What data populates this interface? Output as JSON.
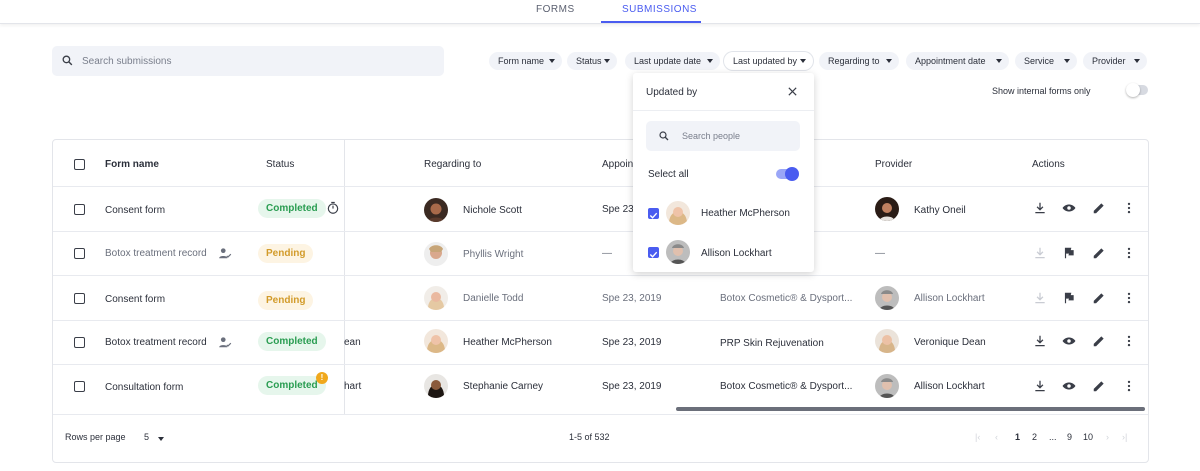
{
  "nav": {
    "tabs": [
      {
        "label": "FORMS"
      },
      {
        "label": "SUBMISSIONS"
      }
    ]
  },
  "search": {
    "placeholder": "Search submissions"
  },
  "filters": [
    "Form name",
    "Status",
    "Last update date",
    "Last updated by",
    "Regarding to",
    "Appointment date",
    "Service",
    "Provider"
  ],
  "internal_toggle": {
    "label": "Show internal forms only",
    "on": false
  },
  "table": {
    "headers": {
      "form_name": "Form name",
      "status": "Status",
      "regarding": "Regarding to",
      "appointment": "Appoin",
      "provider": "Provider",
      "actions": "Actions"
    },
    "rows": [
      {
        "form": "Consent form",
        "status": "Completed",
        "partial": "",
        "regarding": "Nichole Scott",
        "date": "Spe 23",
        "service": "",
        "provider": "Kathy Oneil"
      },
      {
        "form": "Botox treatment record",
        "status": "Pending",
        "partial": "",
        "regarding": "Phyllis Wright",
        "date": "—",
        "service": "",
        "provider": "—"
      },
      {
        "form": "Consent form",
        "status": "Pending",
        "partial": "",
        "regarding": "Danielle Todd",
        "date": "Spe 23, 2019",
        "service": "Botox Cosmetic® & Dysport...",
        "provider": "Allison Lockhart"
      },
      {
        "form": "Botox treatment record",
        "status": "Completed",
        "partial": "ean",
        "regarding": "Heather McPherson",
        "date": "Spe 23, 2019",
        "service": "PRP Skin Rejuvenation",
        "provider": "Veronique Dean"
      },
      {
        "form": "Consultation form",
        "status": "Completed",
        "partial": "hart",
        "regarding": "Stephanie Carney",
        "date": "Spe 23, 2019",
        "service": "Botox Cosmetic® & Dysport...",
        "provider": "Allison Lockhart"
      }
    ]
  },
  "footer": {
    "rows_per_page_label": "Rows per page",
    "rows_per_page_value": "5",
    "range": "1-5 of 532",
    "pages": [
      "1",
      "2",
      "...",
      "9",
      "10"
    ]
  },
  "dropdown": {
    "title": "Updated by",
    "search_placeholder": "Search people",
    "select_all": "Select all",
    "people": [
      "Heather McPherson",
      "Allison Lockhart"
    ]
  },
  "colors": {
    "accent": "#4a5cf0",
    "completed": "#2a9d52",
    "pending": "#d29b2a",
    "warning": "#f0a81c"
  }
}
